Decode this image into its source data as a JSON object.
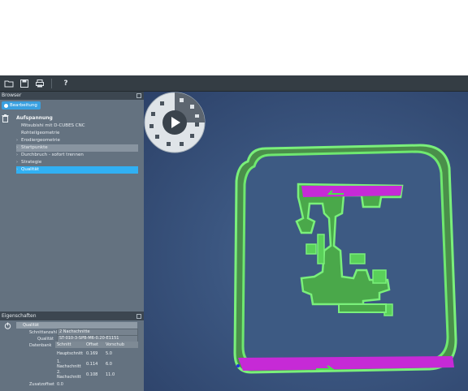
{
  "toolbar": {
    "open_icon": "folder-open-icon",
    "save_icon": "save-icon",
    "print_icon": "print-icon",
    "help_label": "?"
  },
  "browser": {
    "title": "Browser",
    "tab_label": "Bearbeitung",
    "root_label": "Aufspannung",
    "items": [
      {
        "label": "Mitsubishi mit D-CUBES CNC",
        "arrow": ""
      },
      {
        "label": "Rohteilgeometrie",
        "arrow": ""
      },
      {
        "label": "Erodiergeometrie",
        "arrow": "›"
      },
      {
        "label": "Startpunkte",
        "arrow": "›"
      },
      {
        "label": "Durchbruch - sofort trennen",
        "arrow": "›"
      },
      {
        "label": "Strategie",
        "arrow": "›"
      },
      {
        "label": "Qualität",
        "arrow": "›"
      }
    ]
  },
  "properties": {
    "title": "Eigenschaften",
    "section": "Qualität",
    "schnittanzahl_label": "Schnittanzahl",
    "schnittanzahl_value": "2 Nachschnitte",
    "qualitaet_label": "Qualität",
    "qualitaet_value": "ST-010-3-SPB-M6-0.20-E1151",
    "datenbank_label": "Datenbank",
    "zusatzoffset_label": "Zusatzoffset",
    "zusatzoffset_value": "0.0",
    "table": {
      "headers": [
        "Schnitt",
        "Offset",
        "Vorschub"
      ],
      "rows": [
        [
          "Hauptschnitt",
          "0.169",
          "5.0"
        ],
        [
          "1. Nachschnitt",
          "0.114",
          "6.0"
        ],
        [
          "2. Nachschnitt",
          "0.108",
          "11.0"
        ]
      ]
    }
  },
  "colors": {
    "part_green": "#5ce05c",
    "highlight_magenta": "#c62ad6",
    "active_row": "#31b0f3"
  }
}
